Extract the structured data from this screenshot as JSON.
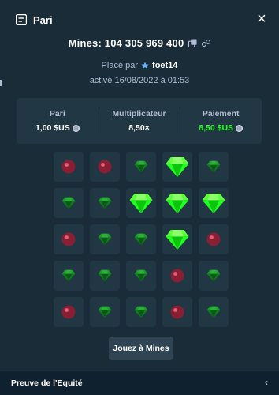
{
  "header": {
    "title": "Pari",
    "close_label": "×"
  },
  "bet": {
    "title": "Mines: 104 305 969 400",
    "placed_by_label": "Placé par",
    "username": "foet14",
    "date_text": "activé 16/08/2022 à 01:53"
  },
  "stats": [
    {
      "label": "Pari",
      "value": "1,00 $US",
      "coin": true,
      "highlight": false
    },
    {
      "label": "Multiplicateur",
      "value": "8,50×",
      "coin": false,
      "highlight": false
    },
    {
      "label": "Paiement",
      "value": "8,50 $US",
      "coin": true,
      "highlight": true
    }
  ],
  "grid": {
    "rows": [
      [
        "mine",
        "mine",
        "gem",
        "gem-revealed",
        "gem"
      ],
      [
        "gem",
        "gem",
        "gem-revealed",
        "gem-revealed",
        "gem-revealed"
      ],
      [
        "mine",
        "gem",
        "gem",
        "gem-revealed",
        "mine"
      ],
      [
        "gem",
        "gem",
        "gem",
        "mine",
        "gem"
      ],
      [
        "mine",
        "gem",
        "gem",
        "mine",
        "gem"
      ]
    ]
  },
  "actions": {
    "play_label": "Jouez à Mines"
  },
  "footer": {
    "fairness_label": "Preuve de l'Equité",
    "chevron": "‹"
  },
  "colors": {
    "background": "#1a2c38",
    "panel": "#213743",
    "accent_green": "#1fff20",
    "mine_red": "#8a1f33"
  },
  "icons": {
    "header": "bet-slip-icon",
    "copy": "copy-icon",
    "link": "link-icon",
    "user": "star-user-icon",
    "coin": "coin-icon"
  }
}
